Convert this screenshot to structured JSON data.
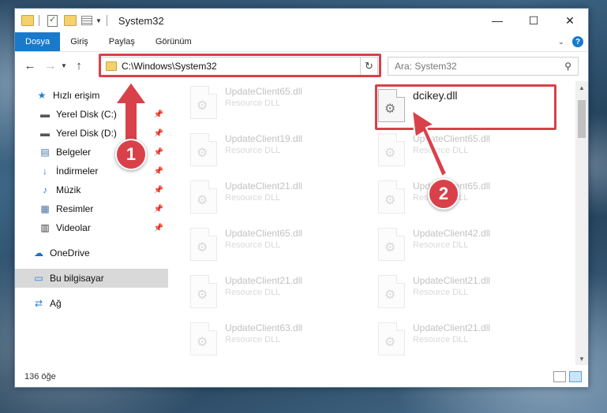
{
  "window": {
    "title": "System32"
  },
  "ribbon": {
    "tabs": [
      "Dosya",
      "Giriş",
      "Paylaş",
      "Görünüm"
    ],
    "active_tab": "Dosya"
  },
  "address": {
    "path": "C:\\Windows\\System32"
  },
  "search": {
    "placeholder": "Ara: System32"
  },
  "nav": {
    "items": [
      {
        "label": "Hızlı erişim",
        "icon": "star-icon"
      },
      {
        "label": "Yerel Disk (C:)",
        "icon": "drive-icon",
        "pinned": true
      },
      {
        "label": "Yerel Disk (D:)",
        "icon": "drive-icon",
        "pinned": true
      },
      {
        "label": "Belgeler",
        "icon": "documents-icon",
        "pinned": true
      },
      {
        "label": "İndirmeler",
        "icon": "download-icon",
        "pinned": true
      },
      {
        "label": "Müzik",
        "icon": "music-icon",
        "pinned": true
      },
      {
        "label": "Resimler",
        "icon": "pictures-icon",
        "pinned": true
      },
      {
        "label": "Videolar",
        "icon": "videos-icon",
        "pinned": true
      },
      {
        "label": "OneDrive",
        "icon": "cloud-icon"
      },
      {
        "label": "Bu bilgisayar",
        "icon": "computer-icon",
        "selected": true
      },
      {
        "label": "Ağ",
        "icon": "network-icon"
      }
    ]
  },
  "files": {
    "left": [
      {
        "name": "UpdateClient65.dll",
        "type": "Resource DLL"
      },
      {
        "name": "UpdateClient19.dll",
        "type": "Resource DLL"
      },
      {
        "name": "UpdateClient21.dll",
        "type": "Resource DLL"
      },
      {
        "name": "UpdateClient65.dll",
        "type": "Resource DLL"
      },
      {
        "name": "UpdateClient21.dll",
        "type": "Resource DLL"
      },
      {
        "name": "UpdateClient63.dll",
        "type": "Resource DLL"
      }
    ],
    "right": [
      {
        "name": "dcikey.dll",
        "type": ""
      },
      {
        "name": "UpdateClient65.dll",
        "type": "Resource DLL"
      },
      {
        "name": "UpdateClient65.dll",
        "type": "Resource DLL"
      },
      {
        "name": "UpdateClient42.dll",
        "type": "Resource DLL"
      },
      {
        "name": "UpdateClient21.dll",
        "type": "Resource DLL"
      },
      {
        "name": "UpdateClient21.dll",
        "type": "Resource DLL"
      }
    ]
  },
  "status": {
    "item_count": "136 öğe"
  },
  "callouts": {
    "one": "1",
    "two": "2"
  },
  "colors": {
    "accent": "#1979ca",
    "highlight": "#d9414a"
  }
}
